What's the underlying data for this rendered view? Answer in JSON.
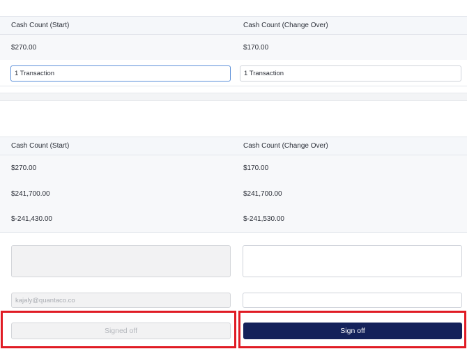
{
  "section1": {
    "col_start_header": "Cash Count (Start)",
    "col_change_header": "Cash Count (Change Over)",
    "start_value": "$270.00",
    "change_value": "$170.00",
    "start_transaction_input": "1 Transaction",
    "change_transaction_input": "1 Transaction"
  },
  "section2": {
    "col_start_header": "Cash Count (Start)",
    "col_change_header": "Cash Count (Change Over)",
    "rows": [
      {
        "start": "$270.00",
        "change": "$170.00"
      },
      {
        "start": "$241,700.00",
        "change": "$241,700.00"
      },
      {
        "start": "$-241,430.00",
        "change": "$-241,530.00"
      }
    ]
  },
  "signoff": {
    "start_email_value": "kajaly@quantaco.co",
    "change_email_value": "",
    "start_button_label": "Signed off",
    "change_button_label": "Sign off"
  },
  "colors": {
    "primary": "#14215a",
    "highlight": "#e01b24",
    "focus": "#5b8fd9"
  }
}
